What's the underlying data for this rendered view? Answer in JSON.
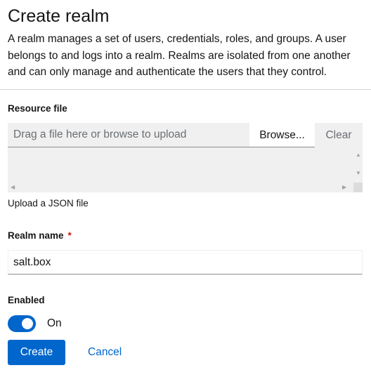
{
  "page": {
    "title": "Create realm",
    "description": "A realm manages a set of users, credentials, roles, and groups. A user belongs to and logs into a realm. Realms are isolated from one another and can only manage and authenticate the users that they control."
  },
  "resource_file": {
    "label": "Resource file",
    "placeholder": "Drag a file here or browse to upload",
    "browse_label": "Browse...",
    "clear_label": "Clear",
    "helper_text": "Upload a JSON file"
  },
  "realm_name": {
    "label": "Realm name",
    "required_marker": "*",
    "value": "salt.box"
  },
  "enabled": {
    "label": "Enabled",
    "state_text": "On",
    "checked": true
  },
  "actions": {
    "create_label": "Create",
    "cancel_label": "Cancel"
  },
  "colors": {
    "primary": "#0066cc",
    "required": "#c9190b",
    "input_bg": "#f0f0f0"
  }
}
